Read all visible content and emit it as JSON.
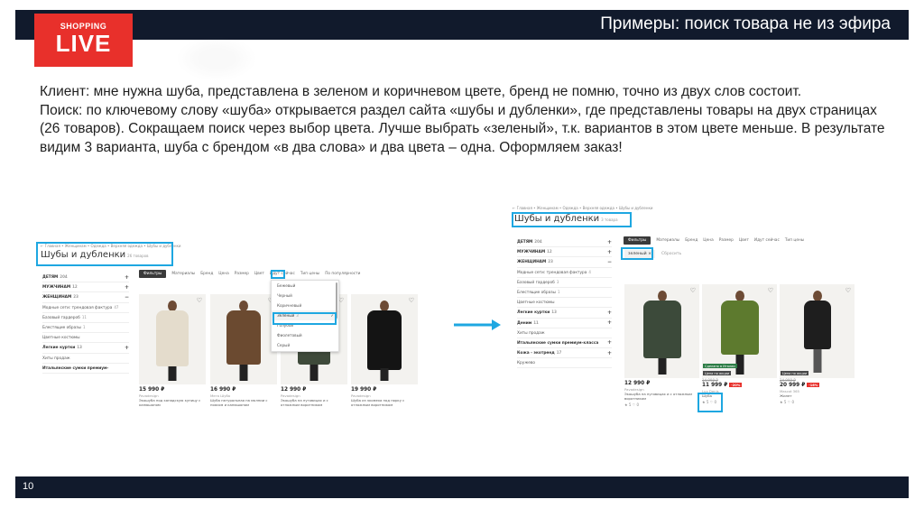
{
  "slide": {
    "title": "Примеры: поиск товара не из эфира",
    "page_number": "10"
  },
  "logo": {
    "line1": "SHOPPING",
    "line2": "LIVE"
  },
  "paragraphs": [
    "Клиент: мне нужна шуба, представлена в зеленом и коричневом цвете, бренд не помню, точно из двух слов состоит.",
    "Поиск: по ключевому слову «шуба» открывается раздел сайта «шубы и дубленки», где представлены товары на двух страницах (26 товаров). Сокращаем поиск через выбор цвета. Лучше выбрать «зеленый», т.к. вариантов в этом цвете меньше. В результате видим 3 варианта, шуба с брендом «в два слова» и два цвета – одна. Оформляем заказ!"
  ],
  "colors": {
    "bar": "#111a2c",
    "brand_red": "#e8302b",
    "highlight": "#1ea7e1"
  },
  "left_screenshot": {
    "breadcrumb": "← Главная • Женщинам • Одежда • Верхняя одежда • Шубы и дубленки",
    "heading": "Шубы и дубленки",
    "count": "26 товаров",
    "sidebar": [
      {
        "label": "ДЕТЯМ",
        "count": "204",
        "sign": "+",
        "bold": true
      },
      {
        "label": "МУЖЧИНАМ",
        "count": "12",
        "sign": "+",
        "bold": true
      },
      {
        "label": "ЖЕНЩИНАМ",
        "count": "23",
        "sign": "−",
        "bold": true
      },
      {
        "label": "Модные сети: трендовая фактура",
        "count": "47",
        "sign": "",
        "bold": false
      },
      {
        "label": "Базовый гардероб",
        "count": "11",
        "sign": "",
        "bold": false
      },
      {
        "label": "Блестящие образы",
        "count": "1",
        "sign": "",
        "bold": false
      },
      {
        "label": "Цветные костюмы",
        "count": "",
        "sign": "",
        "bold": false
      },
      {
        "label": "Легкие куртки",
        "count": "13",
        "sign": "+",
        "bold": true
      },
      {
        "label": "Хиты продаж",
        "count": "",
        "sign": "",
        "bold": false
      },
      {
        "label": "Итальянские сумки премиум-",
        "count": "",
        "sign": "",
        "bold": true
      }
    ],
    "filter_button": "Фильтры",
    "filters": [
      "Материалы",
      "Бренд",
      "Цена",
      "Размер",
      "Цвет",
      "Идут сейчас",
      "Тип цены",
      "По популярности"
    ],
    "color_options": [
      "Бежевый",
      "Черный",
      "Коричневый",
      "Зеленый",
      "Голубой",
      "Фиолетовый",
      "Серый"
    ],
    "color_counts": [
      "",
      "",
      "",
      "3",
      "",
      "",
      ""
    ],
    "selected_color": "Зеленый",
    "check": "✓",
    "products": [
      {
        "price": "15 990 ₽",
        "brand": "Pavadesign",
        "title": "Экошуба под канадскую куницу с капюшоном"
      },
      {
        "price": "16 990 ₽",
        "brand": "Мега Шуба",
        "title": "Шуба натуральная на молнии с поясом и капюшоном"
      },
      {
        "price": "12 990 ₽",
        "brand": "Pavadesign",
        "title": "Экошуба на пуговицах и с отложным воротником"
      },
      {
        "price": "19 990 ₽",
        "brand": "Pavadesign",
        "title": "Шуба из экомеха под норку с отложным воротником"
      }
    ]
  },
  "right_screenshot": {
    "breadcrumb": "← Главная • Женщинам • Одежда • Верхняя одежда • Шубы и дубленки",
    "heading": "Шубы и дубленки",
    "count": "3 товара",
    "filter_button": "Фильтры",
    "filters": [
      "Материалы",
      "Бренд",
      "Цена",
      "Размер",
      "Цвет",
      "Идут сейчас",
      "Тип цены"
    ],
    "chip": "зеленый ×",
    "reset": "Сбросить",
    "sidebar": [
      {
        "label": "ДЕТЯМ",
        "count": "204",
        "sign": "+",
        "bold": true
      },
      {
        "label": "МУЖЧИНАМ",
        "count": "12",
        "sign": "+",
        "bold": true
      },
      {
        "label": "ЖЕНЩИНАМ",
        "count": "23",
        "sign": "−",
        "bold": true
      },
      {
        "label": "Модные сети: трендовая фактура",
        "count": "4",
        "sign": "",
        "bold": false
      },
      {
        "label": "Базовый гардероб",
        "count": "3",
        "sign": "",
        "bold": false
      },
      {
        "label": "Блестящие образы",
        "count": "1",
        "sign": "",
        "bold": false
      },
      {
        "label": "Цветные костюмы",
        "count": "",
        "sign": "",
        "bold": false
      },
      {
        "label": "Легкие куртки",
        "count": "13",
        "sign": "+",
        "bold": true
      },
      {
        "label": "Деним",
        "count": "11",
        "sign": "+",
        "bold": true
      },
      {
        "label": "Хиты продаж",
        "count": "",
        "sign": "",
        "bold": false
      },
      {
        "label": "Итальянские сумки премиум-класса",
        "count": "",
        "sign": "+",
        "bold": true
      },
      {
        "label": "Кожа - экотренд",
        "count": "17",
        "sign": "+",
        "bold": true
      },
      {
        "label": "Кружево",
        "count": "",
        "sign": "",
        "bold": false
      }
    ],
    "products": [
      {
        "price": "12 990 ₽",
        "old_price": "",
        "discount": "",
        "brand": "Pavadesign",
        "title": "Экошуба на пуговицах и с отложным воротником",
        "badge": "",
        "badge2": "",
        "stars": "★ 5  ♡ 0"
      },
      {
        "price": "11 999 ₽",
        "old_price": "14 990 ₽",
        "discount": "-20%",
        "brand": "Lux Denis",
        "title": "Шуба",
        "badge": "Цена по акции",
        "badge2": "Сделано в Италии",
        "stars": "★ 5  ♡ 0"
      },
      {
        "price": "20 999 ₽",
        "old_price": "24 999 ₽",
        "discount": "-16%",
        "brand": "Mascot 365",
        "title": "Жилет",
        "badge": "Цена по акции",
        "badge2": "",
        "stars": "★ 5  ♡ 0"
      }
    ]
  }
}
